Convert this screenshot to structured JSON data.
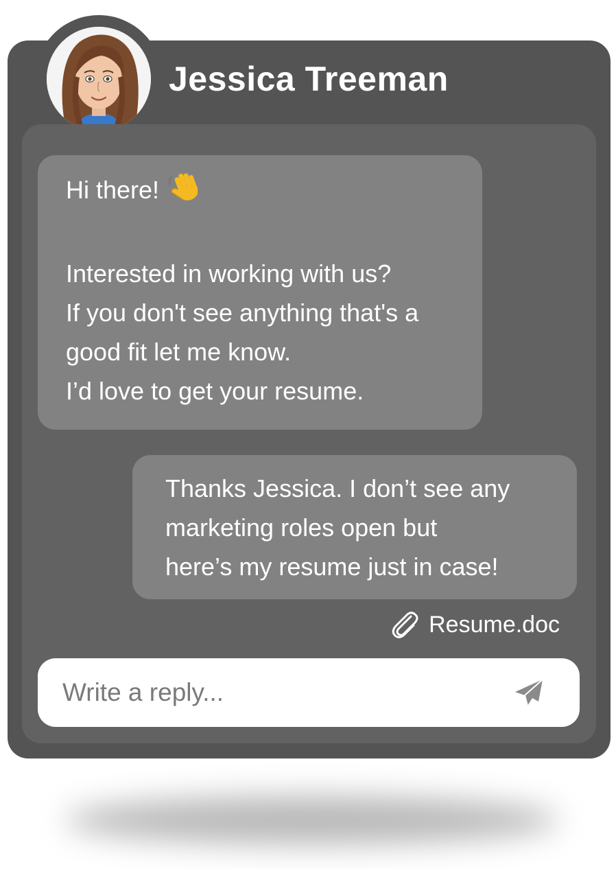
{
  "contact": {
    "name": "Jessica Treeman"
  },
  "messages": {
    "incoming": {
      "line1": "Hi there!",
      "line3": "Interested in working with us?",
      "line4": "If you don't see anything that's a",
      "line5": "good fit let me know.",
      "line6": "I’d love to get your resume."
    },
    "outgoing": {
      "line1": "Thanks Jessica. I don’t see any",
      "line2": "marketing roles open but",
      "line3": "here’s my resume just in case!"
    }
  },
  "attachment": {
    "filename": "Resume.doc",
    "icon": "paperclip-icon"
  },
  "composer": {
    "placeholder": "Write a reply...",
    "send_icon": "send-icon"
  },
  "colors": {
    "frame": "#545454",
    "panel": "#626262",
    "bubble": "#828282",
    "text": "#ffffff",
    "input_bg": "#ffffff"
  }
}
